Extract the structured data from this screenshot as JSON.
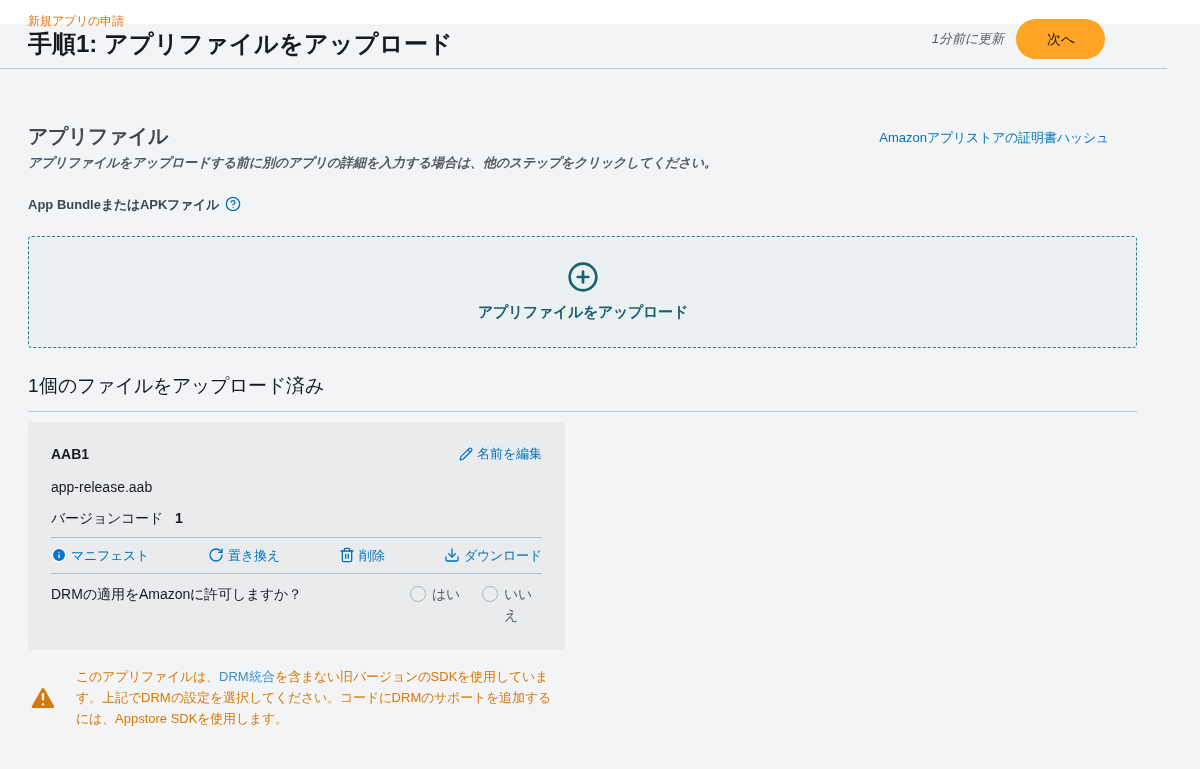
{
  "header": {
    "breadcrumb": "新規アプリの申請",
    "title": "手順1: アプリファイルをアップロード",
    "updated": "1分前に更新",
    "next_button": "次へ"
  },
  "section": {
    "title": "アプリファイル",
    "cert_link": "Amazonアプリストアの証明書ハッシュ",
    "description": "アプリファイルをアップロードする前に別のアプリの詳細を入力する場合は、他のステップをクリックしてください。",
    "field_label": "App BundleまたはAPKファイル",
    "upload_label": "アプリファイルをアップロード"
  },
  "uploaded": {
    "title": "1個のファイルをアップロード済み",
    "files": [
      {
        "name": "AAB1",
        "edit_link": "名前を編集",
        "filename": "app-release.aab",
        "version_label": "バージョンコード",
        "version": "1",
        "actions": [
          {
            "kind": "info",
            "label": "マニフェスト"
          },
          {
            "kind": "replace",
            "label": "置き換え"
          },
          {
            "kind": "delete",
            "label": "削除"
          },
          {
            "kind": "download",
            "label": "ダウンロード"
          }
        ],
        "drm_question": "DRMの適用をAmazonに許可しますか？",
        "options": [
          {
            "label": "はい",
            "selected": false
          },
          {
            "label": "いいえ",
            "selected": false
          }
        ]
      }
    ]
  },
  "warning": {
    "before": "このアプリファイルは、",
    "link": "DRM統合",
    "after": "を含まない旧バージョンのSDKを使用しています。上記でDRMの設定を選択してください。コードにDRMのサポートを追加するには、Appstore SDKを使用します。"
  }
}
